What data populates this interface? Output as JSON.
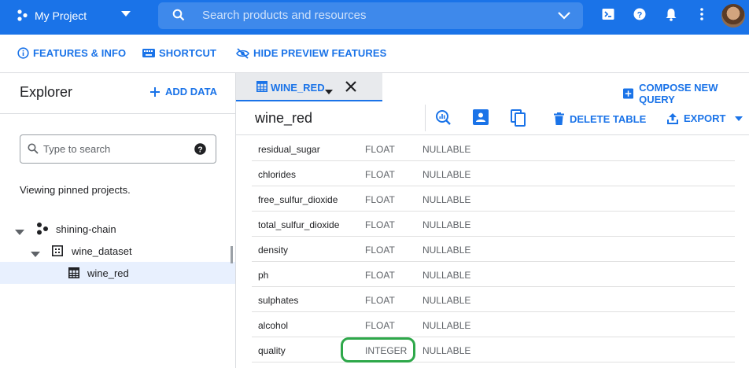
{
  "topbar": {
    "project": "My Project",
    "search_placeholder": "Search products and resources"
  },
  "subbar": {
    "features": "FEATURES & INFO",
    "shortcut": "SHORTCUT",
    "hide_preview": "HIDE PREVIEW FEATURES"
  },
  "explorer": {
    "title": "Explorer",
    "add_data": "ADD DATA",
    "search_placeholder": "Type to search",
    "pinned_text": "Viewing pinned projects.",
    "tree": [
      {
        "label": "shining-chain"
      },
      {
        "label": "wine_dataset"
      },
      {
        "label": "wine_red"
      }
    ]
  },
  "tabs": {
    "active": "WINE_RED",
    "compose": "COMPOSE NEW QUERY"
  },
  "table_bar": {
    "name": "wine_red",
    "delete": "DELETE TABLE",
    "export": "EXPORT"
  },
  "schema": [
    {
      "name": "residual_sugar",
      "type": "FLOAT",
      "mode": "NULLABLE"
    },
    {
      "name": "chlorides",
      "type": "FLOAT",
      "mode": "NULLABLE"
    },
    {
      "name": "free_sulfur_dioxide",
      "type": "FLOAT",
      "mode": "NULLABLE"
    },
    {
      "name": "total_sulfur_dioxide",
      "type": "FLOAT",
      "mode": "NULLABLE"
    },
    {
      "name": "density",
      "type": "FLOAT",
      "mode": "NULLABLE"
    },
    {
      "name": "ph",
      "type": "FLOAT",
      "mode": "NULLABLE"
    },
    {
      "name": "sulphates",
      "type": "FLOAT",
      "mode": "NULLABLE"
    },
    {
      "name": "alcohol",
      "type": "FLOAT",
      "mode": "NULLABLE"
    },
    {
      "name": "quality",
      "type": "INTEGER",
      "mode": "NULLABLE"
    }
  ],
  "colors": {
    "brand": "#1a73e8",
    "highlight": "#2ea84a"
  }
}
